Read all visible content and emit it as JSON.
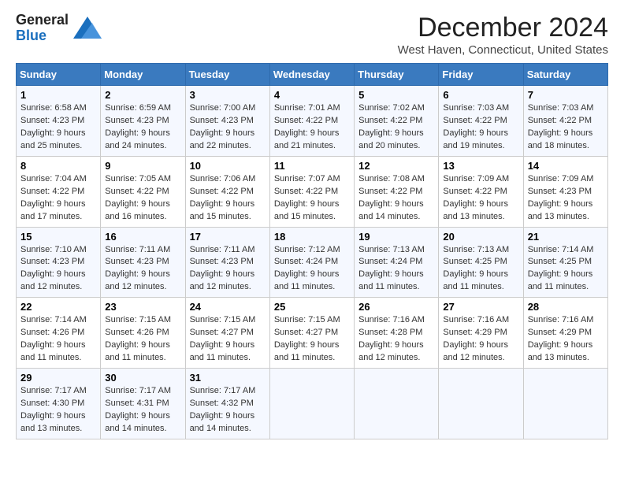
{
  "header": {
    "logo_general": "General",
    "logo_blue": "Blue",
    "month_title": "December 2024",
    "location": "West Haven, Connecticut, United States"
  },
  "calendar": {
    "days_of_week": [
      "Sunday",
      "Monday",
      "Tuesday",
      "Wednesday",
      "Thursday",
      "Friday",
      "Saturday"
    ],
    "weeks": [
      [
        {
          "day": "1",
          "sunrise": "6:58 AM",
          "sunset": "4:23 PM",
          "daylight": "9 hours and 25 minutes."
        },
        {
          "day": "2",
          "sunrise": "6:59 AM",
          "sunset": "4:23 PM",
          "daylight": "9 hours and 24 minutes."
        },
        {
          "day": "3",
          "sunrise": "7:00 AM",
          "sunset": "4:23 PM",
          "daylight": "9 hours and 22 minutes."
        },
        {
          "day": "4",
          "sunrise": "7:01 AM",
          "sunset": "4:22 PM",
          "daylight": "9 hours and 21 minutes."
        },
        {
          "day": "5",
          "sunrise": "7:02 AM",
          "sunset": "4:22 PM",
          "daylight": "9 hours and 20 minutes."
        },
        {
          "day": "6",
          "sunrise": "7:03 AM",
          "sunset": "4:22 PM",
          "daylight": "9 hours and 19 minutes."
        },
        {
          "day": "7",
          "sunrise": "7:03 AM",
          "sunset": "4:22 PM",
          "daylight": "9 hours and 18 minutes."
        }
      ],
      [
        {
          "day": "8",
          "sunrise": "7:04 AM",
          "sunset": "4:22 PM",
          "daylight": "9 hours and 17 minutes."
        },
        {
          "day": "9",
          "sunrise": "7:05 AM",
          "sunset": "4:22 PM",
          "daylight": "9 hours and 16 minutes."
        },
        {
          "day": "10",
          "sunrise": "7:06 AM",
          "sunset": "4:22 PM",
          "daylight": "9 hours and 15 minutes."
        },
        {
          "day": "11",
          "sunrise": "7:07 AM",
          "sunset": "4:22 PM",
          "daylight": "9 hours and 15 minutes."
        },
        {
          "day": "12",
          "sunrise": "7:08 AM",
          "sunset": "4:22 PM",
          "daylight": "9 hours and 14 minutes."
        },
        {
          "day": "13",
          "sunrise": "7:09 AM",
          "sunset": "4:22 PM",
          "daylight": "9 hours and 13 minutes."
        },
        {
          "day": "14",
          "sunrise": "7:09 AM",
          "sunset": "4:23 PM",
          "daylight": "9 hours and 13 minutes."
        }
      ],
      [
        {
          "day": "15",
          "sunrise": "7:10 AM",
          "sunset": "4:23 PM",
          "daylight": "9 hours and 12 minutes."
        },
        {
          "day": "16",
          "sunrise": "7:11 AM",
          "sunset": "4:23 PM",
          "daylight": "9 hours and 12 minutes."
        },
        {
          "day": "17",
          "sunrise": "7:11 AM",
          "sunset": "4:23 PM",
          "daylight": "9 hours and 12 minutes."
        },
        {
          "day": "18",
          "sunrise": "7:12 AM",
          "sunset": "4:24 PM",
          "daylight": "9 hours and 11 minutes."
        },
        {
          "day": "19",
          "sunrise": "7:13 AM",
          "sunset": "4:24 PM",
          "daylight": "9 hours and 11 minutes."
        },
        {
          "day": "20",
          "sunrise": "7:13 AM",
          "sunset": "4:25 PM",
          "daylight": "9 hours and 11 minutes."
        },
        {
          "day": "21",
          "sunrise": "7:14 AM",
          "sunset": "4:25 PM",
          "daylight": "9 hours and 11 minutes."
        }
      ],
      [
        {
          "day": "22",
          "sunrise": "7:14 AM",
          "sunset": "4:26 PM",
          "daylight": "9 hours and 11 minutes."
        },
        {
          "day": "23",
          "sunrise": "7:15 AM",
          "sunset": "4:26 PM",
          "daylight": "9 hours and 11 minutes."
        },
        {
          "day": "24",
          "sunrise": "7:15 AM",
          "sunset": "4:27 PM",
          "daylight": "9 hours and 11 minutes."
        },
        {
          "day": "25",
          "sunrise": "7:15 AM",
          "sunset": "4:27 PM",
          "daylight": "9 hours and 11 minutes."
        },
        {
          "day": "26",
          "sunrise": "7:16 AM",
          "sunset": "4:28 PM",
          "daylight": "9 hours and 12 minutes."
        },
        {
          "day": "27",
          "sunrise": "7:16 AM",
          "sunset": "4:29 PM",
          "daylight": "9 hours and 12 minutes."
        },
        {
          "day": "28",
          "sunrise": "7:16 AM",
          "sunset": "4:29 PM",
          "daylight": "9 hours and 13 minutes."
        }
      ],
      [
        {
          "day": "29",
          "sunrise": "7:17 AM",
          "sunset": "4:30 PM",
          "daylight": "9 hours and 13 minutes."
        },
        {
          "day": "30",
          "sunrise": "7:17 AM",
          "sunset": "4:31 PM",
          "daylight": "9 hours and 14 minutes."
        },
        {
          "day": "31",
          "sunrise": "7:17 AM",
          "sunset": "4:32 PM",
          "daylight": "9 hours and 14 minutes."
        },
        null,
        null,
        null,
        null
      ]
    ],
    "labels": {
      "sunrise": "Sunrise:",
      "sunset": "Sunset:",
      "daylight": "Daylight:"
    }
  }
}
